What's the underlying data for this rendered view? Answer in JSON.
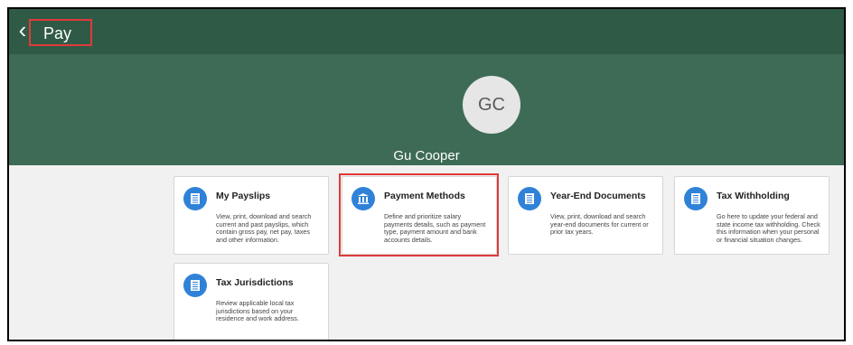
{
  "header": {
    "back_icon": "chevron-left-icon",
    "title": "Pay"
  },
  "profile": {
    "initials": "GC",
    "name": "Gu Cooper"
  },
  "cards": [
    {
      "title": "My Payslips",
      "description": "View, print, download and search current and past payslips, which contain gross pay, net pay, taxes and other information.",
      "icon": "document-icon"
    },
    {
      "title": "Payment Methods",
      "description": "Define and prioritize salary payments details, such as payment type, payment amount and bank accounts details.",
      "icon": "bank-icon"
    },
    {
      "title": "Year-End Documents",
      "description": "View, print, download and search year-end documents for current or prior tax years.",
      "icon": "document-icon"
    },
    {
      "title": "Tax Withholding",
      "description": "Go here to update your federal and state income tax withholding. Check this information when your personal or financial situation changes.",
      "icon": "document-icon"
    },
    {
      "title": "Tax Jurisdictions",
      "description": "Review applicable local tax jurisdictions based on your residence and work address.",
      "icon": "document-icon"
    }
  ],
  "colors": {
    "header_bg": "#2f5a46",
    "hero_bg": "#3d6b56",
    "icon_blue": "#2f82d7",
    "highlight_red": "#e03a3a"
  }
}
